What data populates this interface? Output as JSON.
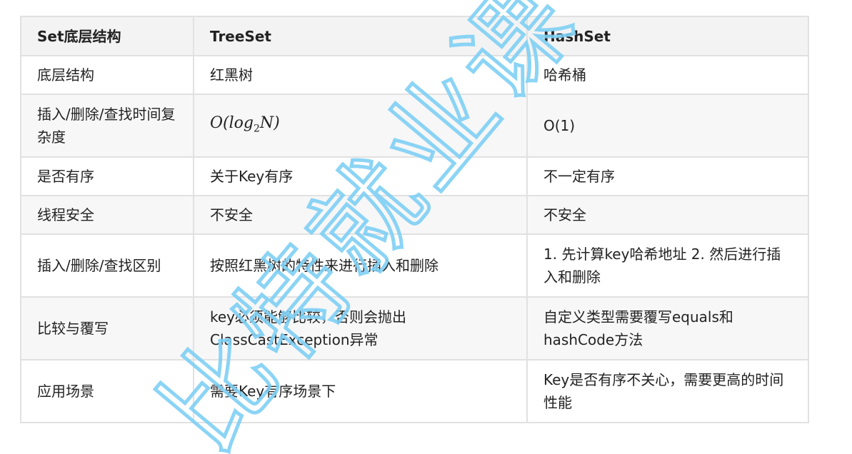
{
  "table": {
    "headers": [
      "Set底层结构",
      "TreeSet",
      "HashSet"
    ],
    "rows": [
      {
        "label": "底层结构",
        "treeset": "红黑树",
        "hashset": "哈希桶"
      },
      {
        "label": "插入/删除/查找时间复杂度",
        "treeset_math": {
          "o": "O(",
          "log": "log",
          "sub": "2",
          "n": "N)"
        },
        "hashset": "O(1)"
      },
      {
        "label": "是否有序",
        "treeset": "关于Key有序",
        "hashset": "不一定有序"
      },
      {
        "label": "线程安全",
        "treeset": "不安全",
        "hashset": "不安全"
      },
      {
        "label": "插入/删除/查找区别",
        "treeset": "按照红黑树的特性来进行插入和删除",
        "hashset": "1. 先计算key哈希地址 2. 然后进行插入和删除"
      },
      {
        "label": "比较与覆写",
        "treeset": "key必须能够比较，否则会抛出ClassCastException异常",
        "hashset": "自定义类型需要覆写equals和hashCode方法"
      },
      {
        "label": "应用场景",
        "treeset": "需要Key有序场景下",
        "hashset": "Key是否有序不关心，需要更高的时间性能"
      }
    ]
  },
  "watermark": {
    "text": "比特就业课",
    "color": "#7fd0f5"
  }
}
